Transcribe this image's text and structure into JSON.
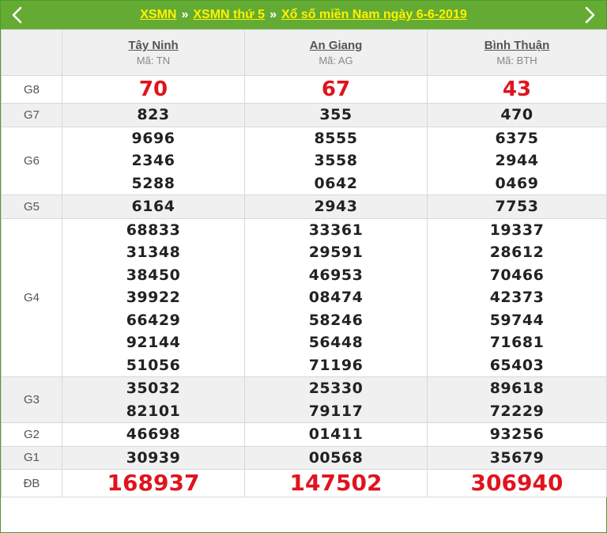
{
  "header": {
    "crumbs": [
      "XSMN",
      "XSMN thứ 5",
      "Xổ số miền Nam ngày 6-6-2019"
    ],
    "separator": "»"
  },
  "provinces": [
    {
      "name": "Tây Ninh",
      "code": "Mã: TN"
    },
    {
      "name": "An Giang",
      "code": "Mã: AG"
    },
    {
      "name": "Bình Thuận",
      "code": "Mã: BTH"
    }
  ],
  "prizes": [
    {
      "label": "G8",
      "values": [
        [
          "70"
        ],
        [
          "67"
        ],
        [
          "43"
        ]
      ]
    },
    {
      "label": "G7",
      "values": [
        [
          "823"
        ],
        [
          "355"
        ],
        [
          "470"
        ]
      ]
    },
    {
      "label": "G6",
      "values": [
        [
          "9696",
          "2346",
          "5288"
        ],
        [
          "8555",
          "3558",
          "0642"
        ],
        [
          "6375",
          "2944",
          "0469"
        ]
      ]
    },
    {
      "label": "G5",
      "values": [
        [
          "6164"
        ],
        [
          "2943"
        ],
        [
          "7753"
        ]
      ]
    },
    {
      "label": "G4",
      "values": [
        [
          "68833",
          "31348",
          "38450",
          "39922",
          "66429",
          "92144",
          "51056"
        ],
        [
          "33361",
          "29591",
          "46953",
          "08474",
          "58246",
          "56448",
          "71196"
        ],
        [
          "19337",
          "28612",
          "70466",
          "42373",
          "59744",
          "71681",
          "65403"
        ]
      ]
    },
    {
      "label": "G3",
      "values": [
        [
          "35032",
          "82101"
        ],
        [
          "25330",
          "79117"
        ],
        [
          "89618",
          "72229"
        ]
      ]
    },
    {
      "label": "G2",
      "values": [
        [
          "46698"
        ],
        [
          "01411"
        ],
        [
          "93256"
        ]
      ]
    },
    {
      "label": "G1",
      "values": [
        [
          "30939"
        ],
        [
          "00568"
        ],
        [
          "35679"
        ]
      ]
    },
    {
      "label": "ĐB",
      "values": [
        [
          "168937"
        ],
        [
          "147502"
        ],
        [
          "306940"
        ]
      ]
    }
  ],
  "colors": {
    "header_bg": "#64ab33",
    "link": "#fff200",
    "highlight": "#e0141e"
  }
}
